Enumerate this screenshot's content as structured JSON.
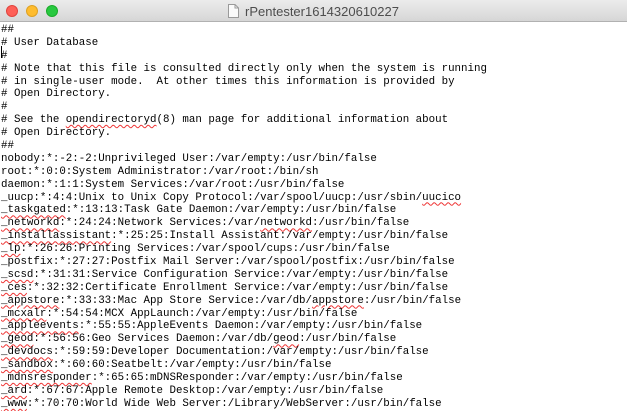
{
  "window": {
    "title": "rPentester1614320610227",
    "controls": {
      "close_icon": "close-icon",
      "minimize_icon": "minimize-icon",
      "zoom_icon": "zoom-icon"
    },
    "title_icon": "document-icon"
  },
  "editor": {
    "lines": [
      "##",
      "# User Database",
      "#",
      "# Note that this file is consulted directly only when the system is running",
      "# in single-user mode.  At other times this information is provided by",
      "# Open Directory.",
      "#",
      "# See the opendirectoryd(8) man page for additional information about",
      "# Open Directory.",
      "##",
      "nobody:*:-2:-2:Unprivileged User:/var/empty:/usr/bin/false",
      "root:*:0:0:System Administrator:/var/root:/bin/sh",
      "daemon:*:1:1:System Services:/var/root:/usr/bin/false",
      "_uucp:*:4:4:Unix to Unix Copy Protocol:/var/spool/uucp:/usr/sbin/uucico",
      "_taskgated:*:13:13:Task Gate Daemon:/var/empty:/usr/bin/false",
      "_networkd:*:24:24:Network Services:/var/networkd:/usr/bin/false",
      "_installassistant:*:25:25:Install Assistant:/var/empty:/usr/bin/false",
      "_lp:*:26:26:Printing Services:/var/spool/cups:/usr/bin/false",
      "_postfix:*:27:27:Postfix Mail Server:/var/spool/postfix:/usr/bin/false",
      "_scsd:*:31:31:Service Configuration Service:/var/empty:/usr/bin/false",
      "_ces:*:32:32:Certificate Enrollment Service:/var/empty:/usr/bin/false",
      "_appstore:*:33:33:Mac App Store Service:/var/db/appstore:/usr/bin/false",
      "_mcxalr:*:54:54:MCX AppLaunch:/var/empty:/usr/bin/false",
      "_appleevents:*:55:55:AppleEvents Daemon:/var/empty:/usr/bin/false",
      "_geod:*:56:56:Geo Services Daemon:/var/db/geod:/usr/bin/false",
      "_devdocs:*:59:59:Developer Documentation:/var/empty:/usr/bin/false",
      "_sandbox:*:60:60:Seatbelt:/var/empty:/usr/bin/false",
      "_mdnsresponder:*:65:65:mDNSResponder:/var/empty:/usr/bin/false",
      "_ard:*:67:67:Apple Remote Desktop:/var/empty:/usr/bin/false",
      "_www:*:70:70:World Wide Web Server:/Library/WebServer:/usr/bin/false"
    ],
    "spellcheck_words": [
      "opendirectoryd",
      "uucico",
      "_taskgated",
      "_networkd",
      "networkd",
      "_installassistant",
      "_lp",
      "_scsd",
      "_ces",
      "_appstore",
      "appstore",
      "_mcxalr",
      "_appleevents",
      "_geod",
      "geod",
      "_devdocs",
      "_sandbox",
      "_mdnsresponder",
      "_ard",
      "_www"
    ]
  }
}
